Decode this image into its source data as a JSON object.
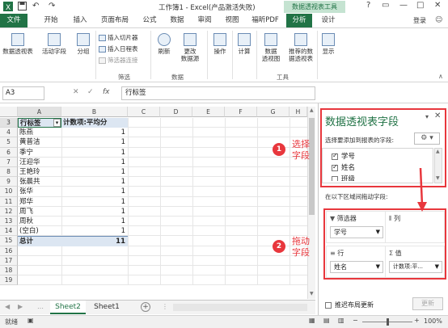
{
  "titlebar": {
    "title": "工作簿1 - Excel(产品激活失败)",
    "context_tab": "数据透视表工具"
  },
  "tabs": [
    {
      "label": "文件"
    },
    {
      "label": "开始"
    },
    {
      "label": "插入"
    },
    {
      "label": "页面布局"
    },
    {
      "label": "公式"
    },
    {
      "label": "数据"
    },
    {
      "label": "审阅"
    },
    {
      "label": "视图"
    },
    {
      "label": "福昕PDF"
    },
    {
      "label": "分析"
    },
    {
      "label": "设计"
    }
  ],
  "account": "登录",
  "ribbon": {
    "pivot_table": "数据透视表",
    "active_field": "活动字段",
    "group": "分组",
    "insert_slicer": "插入切片器",
    "insert_timeline": "插入日程表",
    "filter_connections": "筛选器连接",
    "refresh": "刷新",
    "change_source_1": "更改",
    "change_source_2": "数据源",
    "actions": "操作",
    "calculations": "计算",
    "pivot_chart_1": "数据",
    "pivot_chart_2": "透视图",
    "recommended_1": "推荐的数",
    "recommended_2": "据透视表",
    "show": "显示",
    "group_filter": "筛选",
    "group_data": "数据",
    "group_tools": "工具"
  },
  "formula_bar": {
    "name_box": "A3",
    "cancel": "✕",
    "enter": "✓",
    "fx": "fx",
    "value": "行标签"
  },
  "sheet": {
    "columns": [
      "A",
      "B",
      "C",
      "D",
      "E",
      "F",
      "G",
      "H"
    ],
    "rows": [
      "3",
      "4",
      "5",
      "6",
      "7",
      "8",
      "9",
      "10",
      "11",
      "12",
      "13",
      "14",
      "15",
      "16",
      "17",
      "18",
      "19"
    ],
    "header_row_label": "行标签",
    "header_value_label": "计数项:平均分",
    "pivot_rows": [
      {
        "name": "陈燕",
        "count": "1"
      },
      {
        "name": "黄普洁",
        "count": "1"
      },
      {
        "name": "季宁",
        "count": "1"
      },
      {
        "name": "汪迎华",
        "count": "1"
      },
      {
        "name": "王艳玲",
        "count": "1"
      },
      {
        "name": "张晨共",
        "count": "1"
      },
      {
        "name": "张华",
        "count": "1"
      },
      {
        "name": "郑华",
        "count": "1"
      },
      {
        "name": "周飞",
        "count": "1"
      },
      {
        "name": "周秋",
        "count": "1"
      },
      {
        "name": "(空白)",
        "count": "1"
      }
    ],
    "total_label": "总计",
    "total_value": "11"
  },
  "sheet_tabs": [
    "Sheet2",
    "Sheet1"
  ],
  "status": {
    "ready": "就绪",
    "zoom": "100%"
  },
  "pane": {
    "title": "数据透视表字段",
    "choose_label": "选择要添加到报表的字段:",
    "fields": [
      {
        "label": "学号",
        "checked": true
      },
      {
        "label": "姓名",
        "checked": true
      },
      {
        "label": "班级",
        "checked": false
      }
    ],
    "drag_label": "在以下区域间拖动字段:",
    "zones": {
      "filter_title": "筛选器",
      "filter_item": "学号",
      "columns_title": "列",
      "rows_title": "行",
      "rows_item": "姓名",
      "values_title": "值",
      "values_item": "计数项:平..."
    },
    "defer_label": "推迟布局更新",
    "update_button": "更新"
  },
  "annotations": {
    "step1_num": "1",
    "step1_text_1": "选择",
    "step1_text_2": "字段",
    "step2_num": "2",
    "step2_text_1": "拖动",
    "step2_text_2": "字段"
  },
  "colors": {
    "excel_green": "#217346",
    "annotation_red": "#e8373d",
    "selected_row_blue": "#dce6f2"
  }
}
